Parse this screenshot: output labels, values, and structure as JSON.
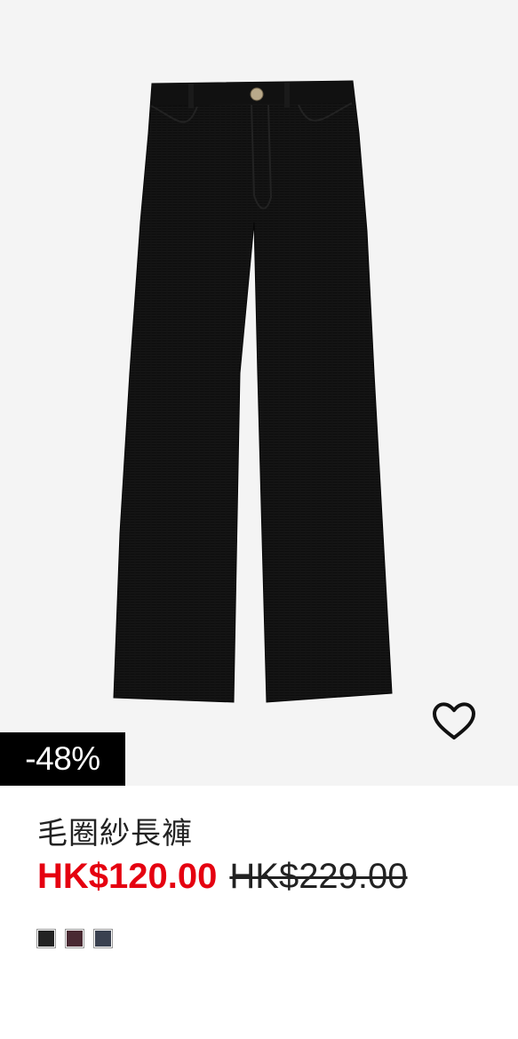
{
  "product": {
    "title": "毛圈紗長褲",
    "sale_price": "HK$120.00",
    "original_price": "HK$229.00",
    "discount": "-48%",
    "image_alt": "black bouclé wide-leg trousers",
    "colors": {
      "sale": "#e50010",
      "background": "#f4f4f4"
    },
    "swatches": [
      {
        "name": "black",
        "color": "#232323"
      },
      {
        "name": "burgundy",
        "color": "#4a2a33"
      },
      {
        "name": "navy",
        "color": "#3a4150"
      }
    ],
    "favorite_icon": "heart-outline-icon"
  }
}
